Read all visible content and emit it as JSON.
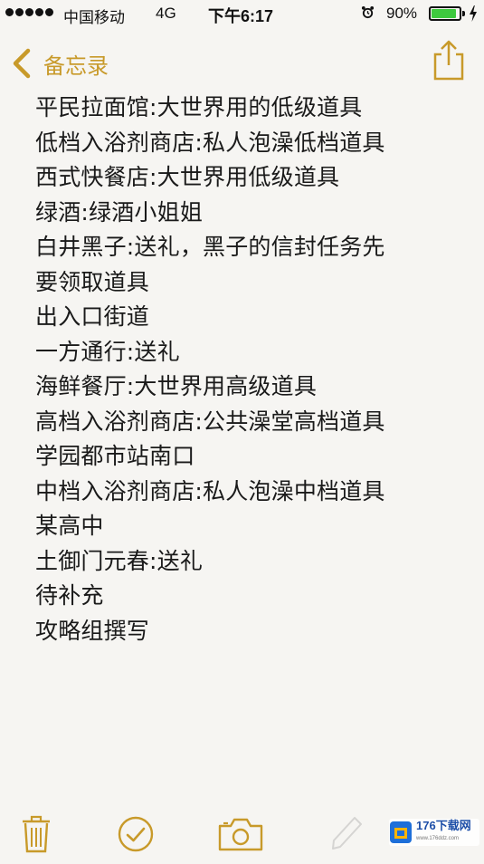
{
  "status_bar": {
    "carrier": "中国移动",
    "network": "4G",
    "time": "下午6:17",
    "battery_percent_text": "90%",
    "battery_level": 0.9,
    "battery_color": "#3ec93e"
  },
  "nav": {
    "back_label": "备忘录",
    "accent_color": "#c89a2a"
  },
  "note": {
    "lines": [
      "平民拉面馆:大世界用的低级道具",
      "低档入浴剂商店:私人泡澡低档道具",
      "西式快餐店:大世界用低级道具",
      "绿酒:绿酒小姐姐",
      "白井黑子:送礼，黑子的信封任务先",
      "要领取道具",
      "出入口街道",
      "一方通行:送礼",
      "海鲜餐厅:大世界用高级道具",
      "高档入浴剂商店:公共澡堂高档道具",
      "学园都市站南口",
      "中档入浴剂商店:私人泡澡中档道具",
      "某高中",
      "土御门元春:送礼",
      "待补充",
      "攻略组撰写"
    ]
  },
  "toolbar": {
    "icons": [
      "trash-icon",
      "checkmark-icon",
      "camera-icon",
      "compose-icon"
    ]
  },
  "watermark": {
    "text": "176下载网",
    "sub": "www.176ddz.com"
  }
}
